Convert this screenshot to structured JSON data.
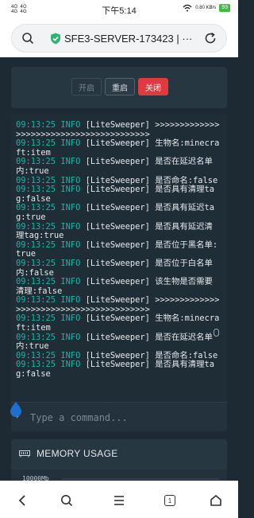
{
  "status_bar": {
    "signal_left": [
      "4G",
      "4G",
      "4G",
      "4G"
    ],
    "time": "下午5:14",
    "speed": "0.80 KB/s",
    "battery": "93"
  },
  "browser": {
    "url_text": "SFE3-SERVER-173423 | ···",
    "icons": [
      "search-icon",
      "shield-check-icon",
      "reload-icon"
    ]
  },
  "server_controls": {
    "start_label": "开启",
    "restart_label": "重启",
    "stop_label": "关闭"
  },
  "console": {
    "lines": [
      {
        "ts": "09:13:25",
        "level": "INFO",
        "msg": "[LiteSweeper] >>>>>>>>>>>>>>>>>>>>>>>>>>>>>>>>>>>>>>>>"
      },
      {
        "ts": "09:13:25",
        "level": "INFO",
        "msg": "[LiteSweeper] 生物名:minecraft:item"
      },
      {
        "ts": "09:13:25",
        "level": "INFO",
        "msg": "[LiteSweeper] 是否在延迟名单内:true"
      },
      {
        "ts": "09:13:25",
        "level": "INFO",
        "msg": "[LiteSweeper] 是否命名:false"
      },
      {
        "ts": "09:13:25",
        "level": "INFO",
        "msg": "[LiteSweeper] 是否具有清理tag:false"
      },
      {
        "ts": "09:13:25",
        "level": "INFO",
        "msg": "[LiteSweeper] 是否具有延迟tag:true"
      },
      {
        "ts": "09:13:25",
        "level": "INFO",
        "msg": "[LiteSweeper] 是否具有延迟清理tag:true"
      },
      {
        "ts": "09:13:25",
        "level": "INFO",
        "msg": "[LiteSweeper] 是否位于黑名单:true"
      },
      {
        "ts": "09:13:25",
        "level": "INFO",
        "msg": "[LiteSweeper] 是否位于白名单内:false"
      },
      {
        "ts": "09:13:25",
        "level": "INFO",
        "msg": "[LiteSweeper] 该生物是否需要清理:false"
      },
      {
        "ts": "09:13:25",
        "level": "INFO",
        "msg": "[LiteSweeper] >>>>>>>>>>>>>>>>>>>>>>>>>>>>>>>>>>>>>>>>"
      },
      {
        "ts": "09:13:25",
        "level": "INFO",
        "msg": "[LiteSweeper] 生物名:minecraft:item"
      },
      {
        "ts": "09:13:25",
        "level": "INFO",
        "msg": "[LiteSweeper] 是否在延迟名单内:true"
      },
      {
        "ts": "09:13:25",
        "level": "INFO",
        "msg": "[LiteSweeper] 是否命名:false"
      },
      {
        "ts": "09:13:25",
        "level": "INFO",
        "msg": "[LiteSweeper] 是否具有清理tag:false"
      }
    ],
    "prompt": "$",
    "input_placeholder": "Type a command..."
  },
  "memory": {
    "title": "MEMORY USAGE",
    "axis_label": "10000Mb"
  },
  "nav_bar": {
    "tab_count": "1"
  },
  "colors": {
    "background": "#1e2a33",
    "panel": "#273742",
    "console_bg": "#1f2d37",
    "log_accent": "#19b5a6",
    "stop_button": "#e03a3e",
    "shield_green": "#2bb673"
  }
}
